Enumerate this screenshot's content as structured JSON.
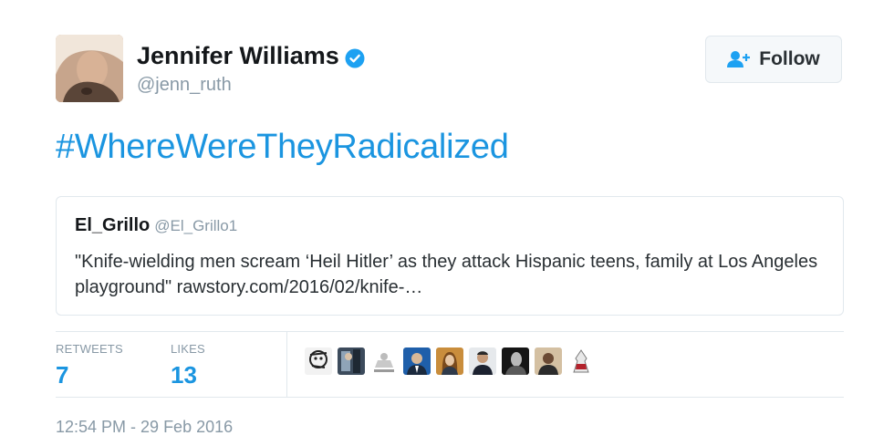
{
  "author": {
    "name": "Jennifer Williams",
    "handle": "@jenn_ruth",
    "verified": true
  },
  "follow_label": "Follow",
  "tweet_text": "#WhereWereTheyRadicalized",
  "quoted_tweet": {
    "name": "El_Grillo",
    "handle": "@El_Grillo1",
    "text": "\"Knife-wielding men scream ‘Heil Hitler’ as they attack Hispanic teens, family at Los Angeles playground\" rawstory.com/2016/02/knife-…"
  },
  "stats": {
    "retweets_label": "RETWEETS",
    "retweets_count": "7",
    "likes_label": "LIKES",
    "likes_count": "13"
  },
  "likers_count_shown": 10,
  "timestamp": "12:54 PM - 29 Feb 2016",
  "colors": {
    "link_blue": "#1b95e0",
    "verified_blue": "#1da1f2",
    "muted_gray": "#8899a6",
    "border": "#e1e8ed"
  }
}
